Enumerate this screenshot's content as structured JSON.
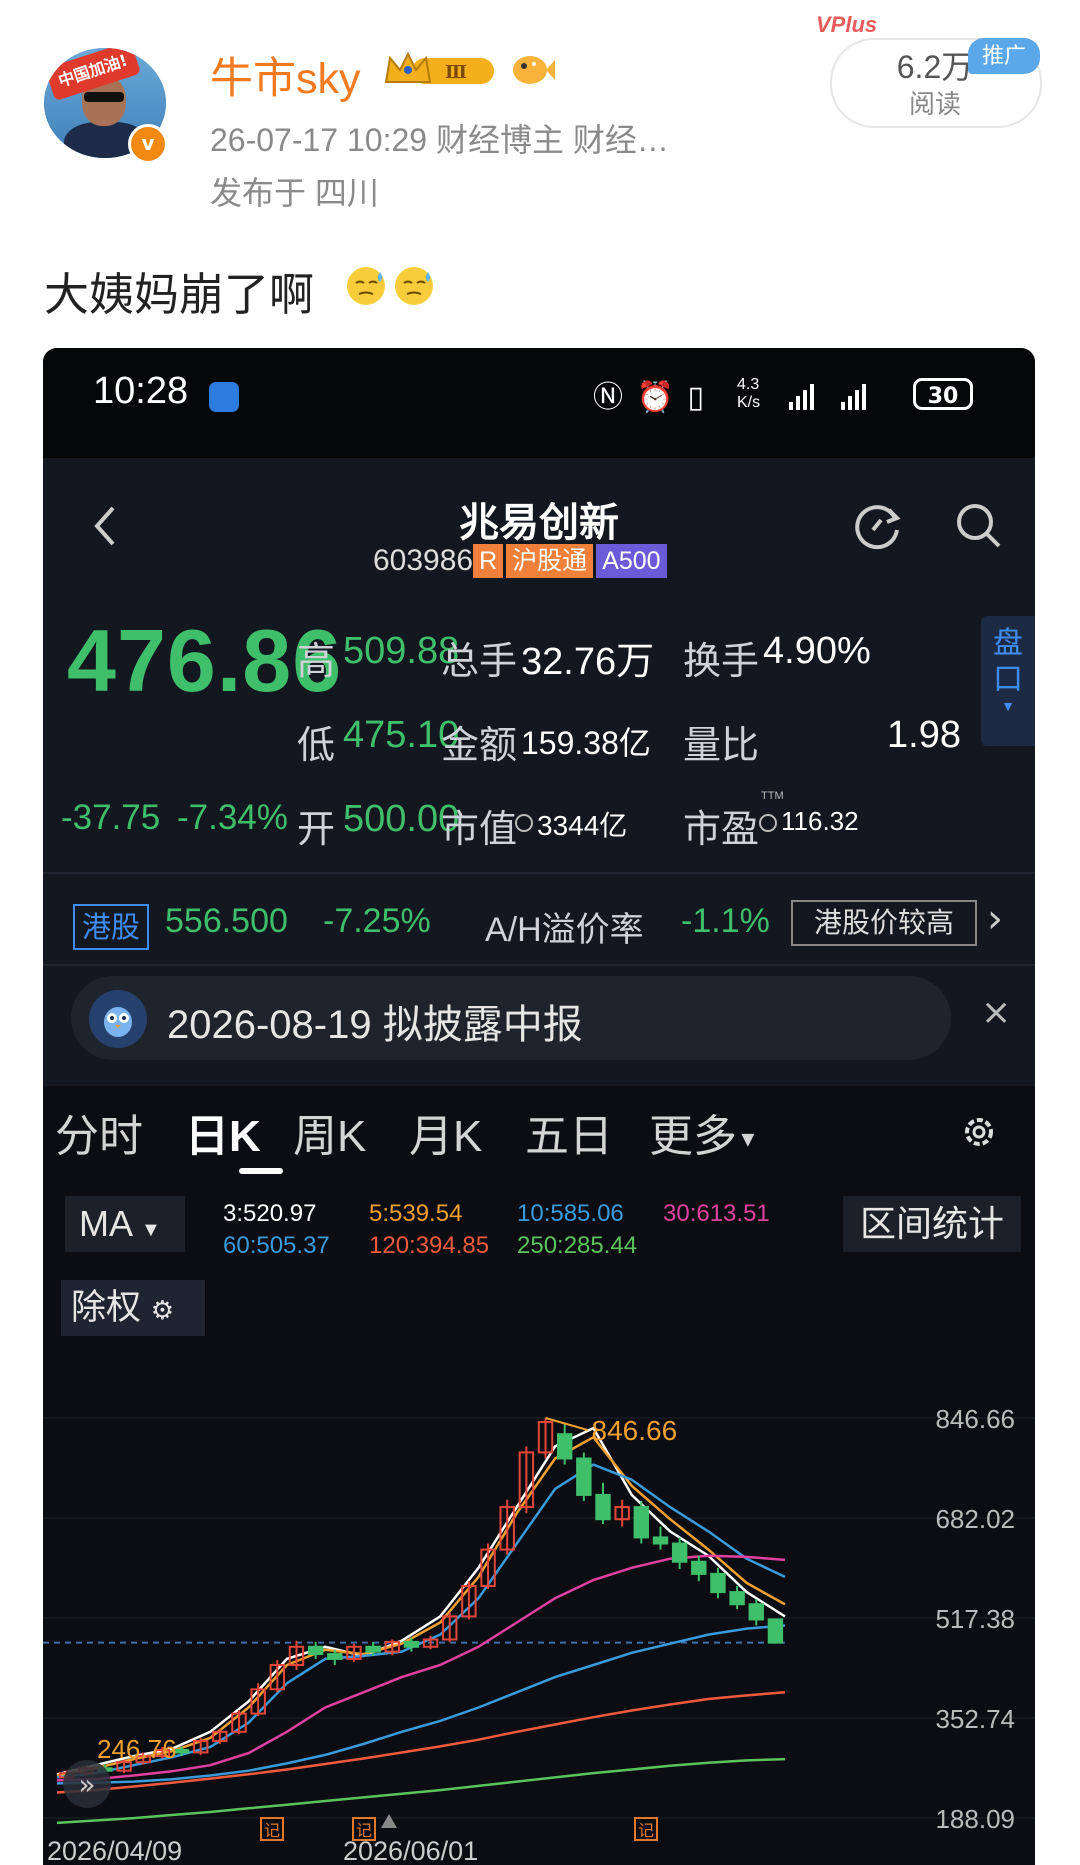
{
  "post": {
    "username": "牛市sky",
    "avatar_flag_text": "中国加油!",
    "meta": "26-07-17 10:29  财经博主 财经…",
    "location": "发布于 四川",
    "reads_count": "6.2万",
    "reads_label": "阅读",
    "promo_tag": "推广",
    "vplus_label": "VPlus",
    "content": "大姨妈崩了啊",
    "level_badge": "Ⅲ"
  },
  "status_bar": {
    "time": "10:28",
    "speed_top": "4.3",
    "speed_bottom": "K/s",
    "battery": "30"
  },
  "stock": {
    "name": "兆易创新",
    "code": "603986",
    "tags": [
      "R",
      "沪股通",
      "A500"
    ],
    "price": "476.86",
    "change": "-37.75",
    "change_pct": "-7.34%",
    "quote": {
      "high_label": "高",
      "high": "509.88",
      "low_label": "低",
      "low": "475.10",
      "open_label": "开",
      "open": "500.00",
      "volume_label": "总手",
      "volume": "32.76万",
      "amount_label": "金额",
      "amount": "159.38亿",
      "mktcap_label": "市值",
      "mktcap": "3344亿",
      "turnover_label": "换手",
      "turnover": "4.90%",
      "vol_ratio_label": "量比",
      "vol_ratio": "1.98",
      "pe_label": "市盈",
      "pe_tag": "TTM",
      "pe": "116.32"
    },
    "pankou_label": "盘口"
  },
  "hk": {
    "label": "港股",
    "price": "556.500",
    "change_pct": "-7.25%",
    "ah_label": "A/H溢价率",
    "ah_value": "-1.1%",
    "note": "港股价较高"
  },
  "notice": {
    "text": "2026-08-19 拟披露中报"
  },
  "tabs": [
    "分时",
    "日K",
    "周K",
    "月K",
    "五日",
    "更多"
  ],
  "indicators": {
    "ma_label": "MA",
    "range_label": "区间统计",
    "chuquan_label": "除权",
    "ma_values": [
      {
        "text": "3:520.97",
        "color": "#ffffff"
      },
      {
        "text": "5:539.54",
        "color": "#f0a030"
      },
      {
        "text": "10:585.06",
        "color": "#3a9bdc"
      },
      {
        "text": "30:613.51",
        "color": "#e040a0"
      },
      {
        "text": "60:505.37",
        "color": "#3a9bdc"
      },
      {
        "text": "120:394.85",
        "color": "#f05a3c"
      },
      {
        "text": "250:285.44",
        "color": "#5cc45c"
      }
    ]
  },
  "chart_data": {
    "type": "candlestick",
    "y_ticks": [
      "846.66",
      "682.02",
      "517.38",
      "352.74",
      "188.09"
    ],
    "x_ticks": [
      "2026/04/09",
      "2026/06/01"
    ],
    "high_annotation": "846.66",
    "low_annotation": "246.76",
    "event_markers": [
      "记",
      "记",
      "记"
    ],
    "current_price_line": 476.86,
    "ylim": [
      188.09,
      846.66
    ],
    "series": [
      {
        "name": "MA3",
        "color": "#ffffff",
        "values": [
          260,
          275,
          290,
          302,
          330,
          380,
          450,
          470,
          455,
          480,
          520,
          600,
          700,
          800,
          830,
          720,
          660,
          620,
          560,
          520
        ]
      },
      {
        "name": "MA5",
        "color": "#f0a030",
        "values": [
          258,
          270,
          285,
          298,
          320,
          370,
          440,
          465,
          458,
          475,
          510,
          585,
          690,
          780,
          815,
          735,
          680,
          630,
          575,
          540
        ]
      },
      {
        "name": "MA10",
        "color": "#3a9bdc",
        "values": [
          255,
          262,
          275,
          288,
          305,
          345,
          410,
          450,
          455,
          462,
          490,
          550,
          640,
          730,
          770,
          745,
          700,
          660,
          615,
          585
        ]
      },
      {
        "name": "MA30",
        "color": "#e040a0",
        "values": [
          250,
          252,
          258,
          265,
          275,
          295,
          330,
          370,
          395,
          420,
          440,
          470,
          510,
          550,
          580,
          600,
          615,
          620,
          618,
          613
        ]
      },
      {
        "name": "MA60",
        "color": "#3a9bdc",
        "values": [
          245,
          246,
          248,
          252,
          258,
          266,
          278,
          292,
          310,
          330,
          348,
          370,
          395,
          420,
          440,
          460,
          475,
          490,
          500,
          505
        ]
      },
      {
        "name": "MA120",
        "color": "#f05a3c",
        "values": [
          230,
          234,
          240,
          246,
          253,
          260,
          268,
          277,
          286,
          296,
          306,
          317,
          330,
          342,
          354,
          365,
          375,
          384,
          390,
          395
        ]
      },
      {
        "name": "MA250",
        "color": "#5cc45c",
        "values": [
          180,
          184,
          188,
          193,
          198,
          204,
          210,
          216,
          222,
          228,
          234,
          241,
          248,
          255,
          262,
          268,
          274,
          279,
          283,
          285
        ]
      }
    ],
    "candles": [
      {
        "o": 255,
        "c": 262,
        "h": 266,
        "l": 250
      },
      {
        "o": 262,
        "c": 270,
        "h": 274,
        "l": 258
      },
      {
        "o": 270,
        "c": 266,
        "h": 276,
        "l": 262
      },
      {
        "o": 266,
        "c": 280,
        "h": 284,
        "l": 262
      },
      {
        "o": 280,
        "c": 290,
        "h": 296,
        "l": 276
      },
      {
        "o": 290,
        "c": 300,
        "h": 305,
        "l": 286
      },
      {
        "o": 300,
        "c": 296,
        "h": 306,
        "l": 290
      },
      {
        "o": 296,
        "c": 315,
        "h": 320,
        "l": 292
      },
      {
        "o": 315,
        "c": 330,
        "h": 335,
        "l": 310
      },
      {
        "o": 330,
        "c": 360,
        "h": 366,
        "l": 326
      },
      {
        "o": 360,
        "c": 400,
        "h": 410,
        "l": 356
      },
      {
        "o": 400,
        "c": 440,
        "h": 448,
        "l": 395
      },
      {
        "o": 440,
        "c": 470,
        "h": 480,
        "l": 432
      },
      {
        "o": 470,
        "c": 458,
        "h": 478,
        "l": 450
      },
      {
        "o": 458,
        "c": 450,
        "h": 465,
        "l": 440
      },
      {
        "o": 450,
        "c": 470,
        "h": 475,
        "l": 445
      },
      {
        "o": 470,
        "c": 462,
        "h": 478,
        "l": 455
      },
      {
        "o": 462,
        "c": 478,
        "h": 482,
        "l": 456
      },
      {
        "o": 478,
        "c": 470,
        "h": 485,
        "l": 462
      },
      {
        "o": 470,
        "c": 482,
        "h": 488,
        "l": 466
      },
      {
        "o": 482,
        "c": 520,
        "h": 526,
        "l": 478
      },
      {
        "o": 520,
        "c": 570,
        "h": 578,
        "l": 515
      },
      {
        "o": 570,
        "c": 630,
        "h": 640,
        "l": 565
      },
      {
        "o": 630,
        "c": 700,
        "h": 712,
        "l": 622
      },
      {
        "o": 700,
        "c": 790,
        "h": 800,
        "l": 690
      },
      {
        "o": 790,
        "c": 840,
        "h": 846.66,
        "l": 780
      },
      {
        "o": 820,
        "c": 780,
        "h": 836,
        "l": 770
      },
      {
        "o": 780,
        "c": 720,
        "h": 790,
        "l": 710
      },
      {
        "o": 720,
        "c": 680,
        "h": 740,
        "l": 672
      },
      {
        "o": 680,
        "c": 700,
        "h": 712,
        "l": 668
      },
      {
        "o": 700,
        "c": 650,
        "h": 710,
        "l": 640
      },
      {
        "o": 650,
        "c": 640,
        "h": 668,
        "l": 630
      },
      {
        "o": 640,
        "c": 610,
        "h": 650,
        "l": 598
      },
      {
        "o": 610,
        "c": 590,
        "h": 620,
        "l": 578
      },
      {
        "o": 590,
        "c": 560,
        "h": 600,
        "l": 550
      },
      {
        "o": 560,
        "c": 540,
        "h": 570,
        "l": 532
      },
      {
        "o": 540,
        "c": 515,
        "h": 548,
        "l": 505
      },
      {
        "o": 515,
        "c": 476.86,
        "h": 509.88,
        "l": 475.1
      }
    ]
  },
  "colors": {
    "up": "#e5463a",
    "down": "#3fbf6a",
    "accent_orange": "#f37a1f",
    "panel_bg": "#131720",
    "blue": "#3f8cf0"
  }
}
